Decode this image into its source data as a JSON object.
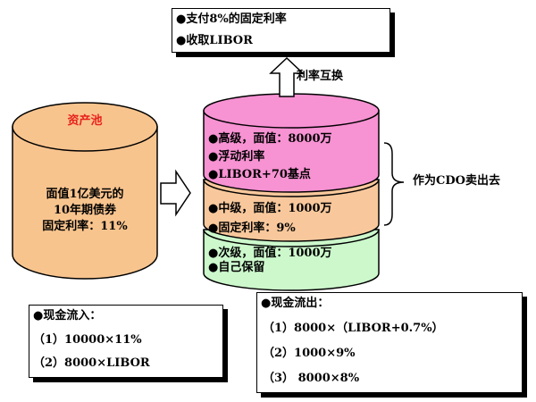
{
  "top_box": {
    "lines": [
      "●支付8%的固定利率",
      "●收取LIBOR"
    ]
  },
  "swap_label": "利率互换",
  "asset_pool": {
    "title": "资产池",
    "lines": [
      "面值1亿美元的",
      "10年期债券",
      "固定利率：11%"
    ]
  },
  "tranches": {
    "senior": [
      "●高级，面值：8000万",
      "●浮动利率",
      "●LIBOR+70基点"
    ],
    "mezzanine": [
      "●中级，面值：1000万",
      "●固定利率：9%"
    ],
    "junior": [
      "●次级，面值：1000万",
      "●自己保留"
    ]
  },
  "sell_label": "作为CDO卖出去",
  "cash_in": {
    "title": "●现金流入：",
    "items": [
      "（1）10000×11%",
      "（2）8000×LIBOR"
    ]
  },
  "cash_out": {
    "title": "●现金流出：",
    "items": [
      "（1）8000×（LIBOR+0.7%）",
      "（2）1000×9%",
      "（3） 8000×8%"
    ]
  },
  "colors": {
    "asset_pool_fill": "#f8c48e",
    "senior_fill": "#f792d3",
    "mezzanine_fill": "#f8c89c",
    "junior_fill": "#ccf8cc",
    "title_red": "#e8211c"
  }
}
